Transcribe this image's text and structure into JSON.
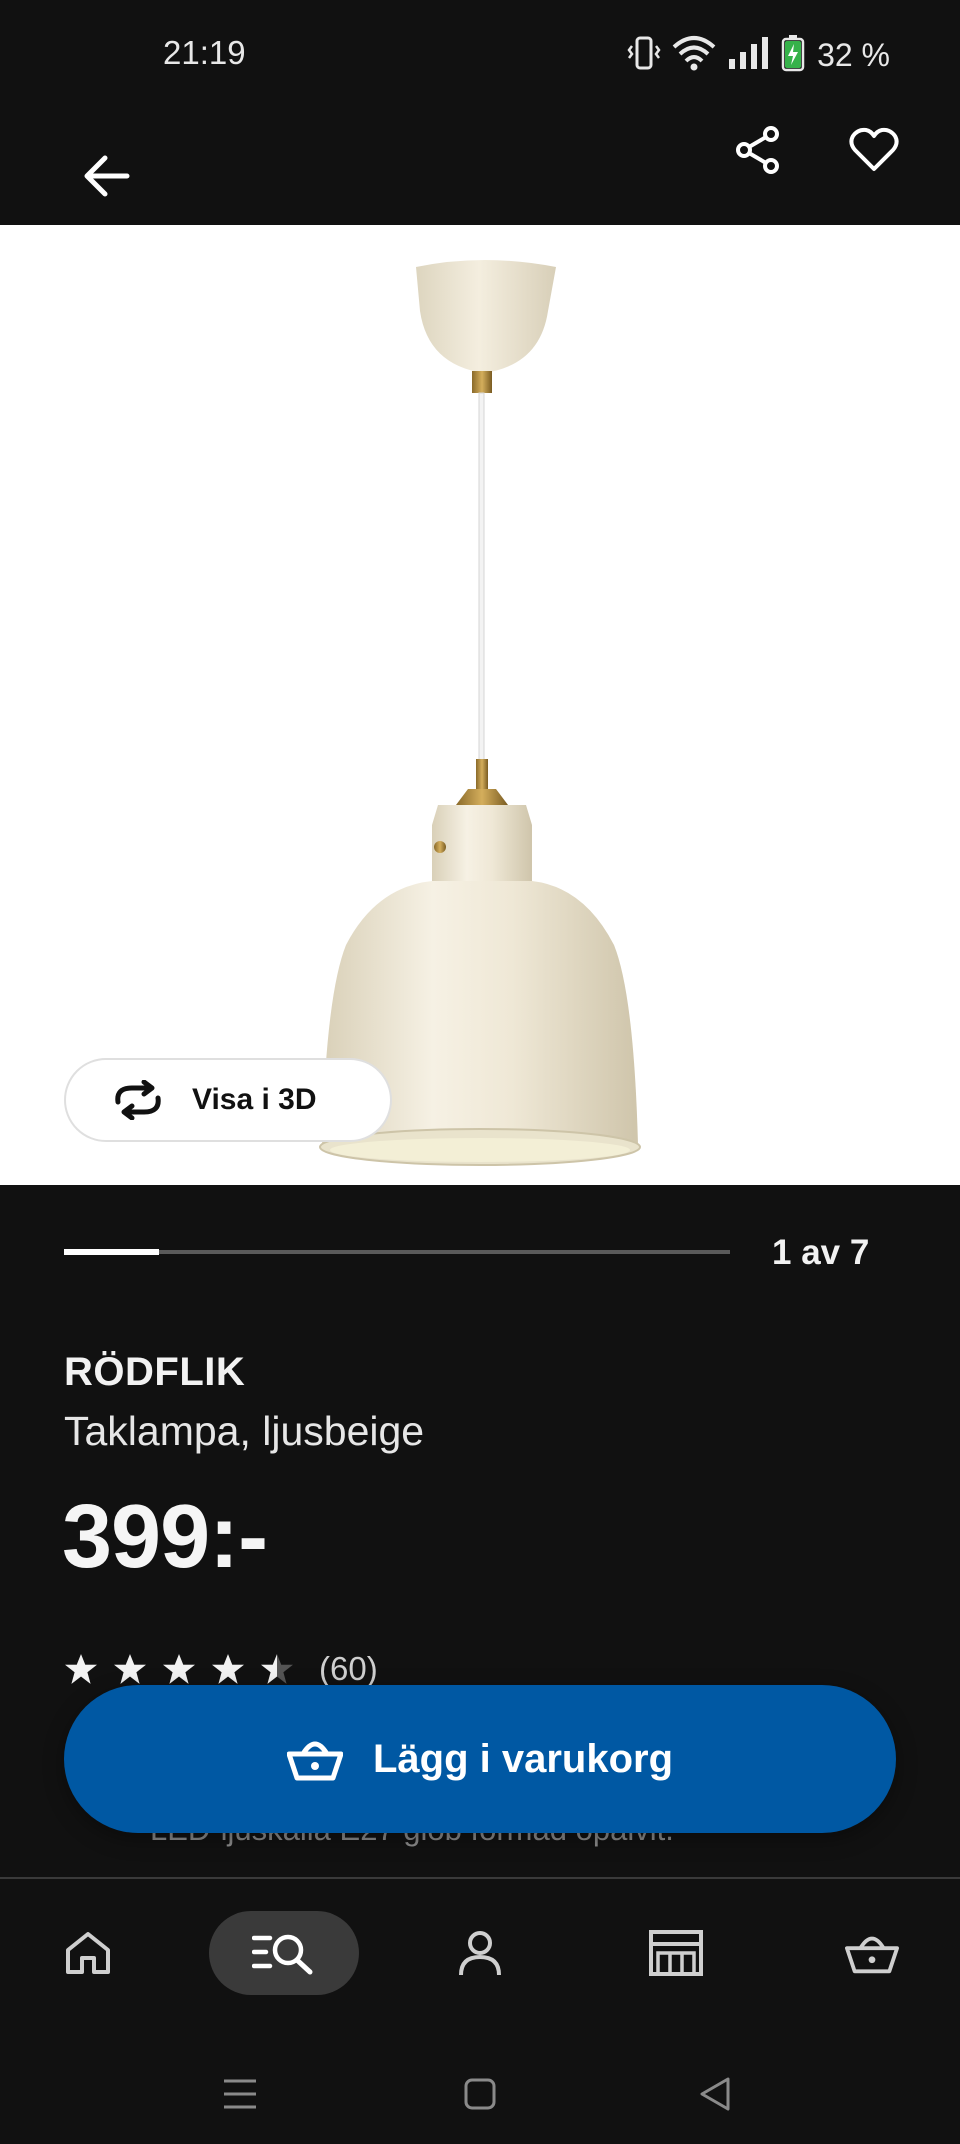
{
  "status_bar": {
    "time": "21:19",
    "battery": "32 %",
    "icons": [
      "vibrate-icon",
      "wifi-icon",
      "signal-icon",
      "battery-charging-icon"
    ]
  },
  "top_bar": {
    "icons": [
      "back-arrow-icon",
      "share-icon",
      "heart-icon"
    ]
  },
  "product_image": {
    "visa_3d_label": "Visa i 3D",
    "colors": {
      "lamp": "#efe8d6",
      "brass": "#b08a3e"
    }
  },
  "gallery": {
    "current": 1,
    "total": 7,
    "label": "1 av 7"
  },
  "product": {
    "name": "RÖDFLIK",
    "description": "Taklampa, ljusbeige",
    "price": "399:-",
    "rating_value": 4.5,
    "rating_max": 5,
    "rating_count": "(60)",
    "partial_info": "LED-ljuskälla E27 glob formad opalvit."
  },
  "cta": {
    "label": "Lägg i varukorg",
    "color": "#0058a3"
  },
  "bottom_nav": {
    "items": [
      {
        "icon": "home-icon",
        "active": false
      },
      {
        "icon": "search-icon",
        "active": true
      },
      {
        "icon": "profile-icon",
        "active": false
      },
      {
        "icon": "store-icon",
        "active": false
      },
      {
        "icon": "basket-icon",
        "active": false
      }
    ]
  },
  "system_nav": {
    "icons": [
      "recents-icon",
      "home-square-icon",
      "back-triangle-icon"
    ]
  }
}
